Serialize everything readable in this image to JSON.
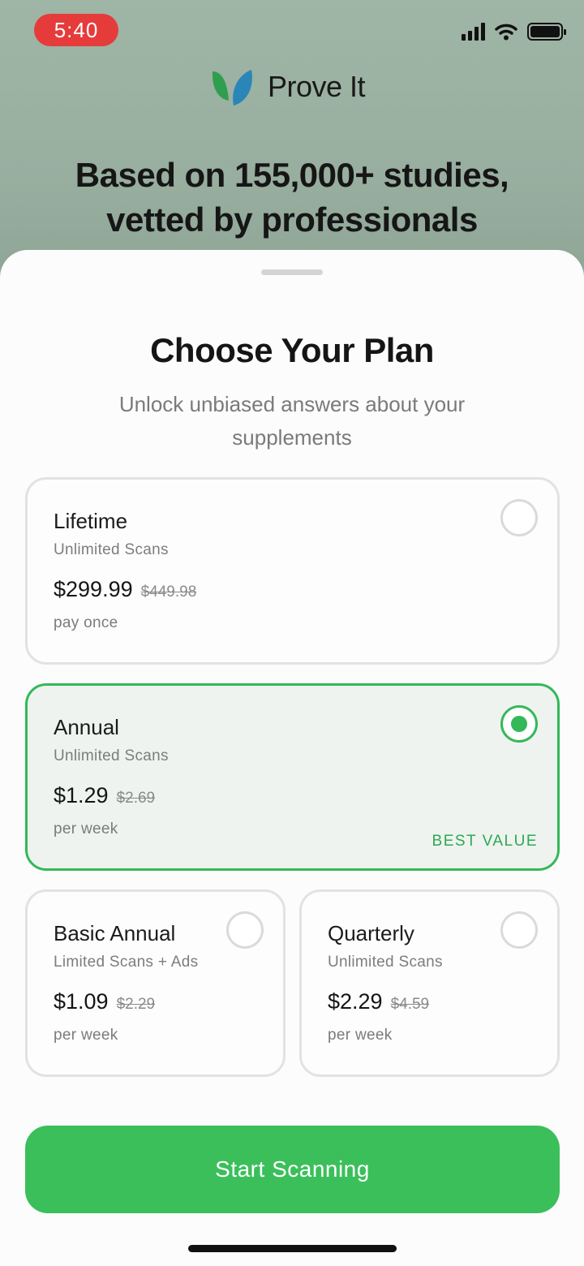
{
  "status_bar": {
    "time": "5:40"
  },
  "brand": {
    "name": "Prove It"
  },
  "hero": {
    "line1": "Based on 155,000+ studies,",
    "line2": "vetted by professionals"
  },
  "sheet": {
    "title": "Choose Your Plan",
    "subtitle": "Unlock unbiased answers about your supplements"
  },
  "plans": [
    {
      "name": "Lifetime",
      "feature": "Unlimited Scans",
      "price": "$299.99",
      "old_price": "$449.98",
      "period": "pay once",
      "selected": false
    },
    {
      "name": "Annual",
      "feature": "Unlimited Scans",
      "price": "$1.29",
      "old_price": "$2.69",
      "period": "per week",
      "badge": "BEST VALUE",
      "selected": true
    },
    {
      "name": "Basic Annual",
      "feature": "Limited Scans + Ads",
      "price": "$1.09",
      "old_price": "$2.29",
      "period": "per week",
      "selected": false
    },
    {
      "name": "Quarterly",
      "feature": "Unlimited Scans",
      "price": "$2.29",
      "old_price": "$4.59",
      "period": "per week",
      "selected": false
    }
  ],
  "cta": {
    "label": "Start Scanning"
  },
  "colors": {
    "accent": "#3bbf5b",
    "time_pill": "#e63b3b",
    "backdrop": "#99b09f"
  },
  "icons": [
    "signal-icon",
    "wifi-icon",
    "battery-icon",
    "prove-it-logo-icon",
    "radio-unselected-icon",
    "radio-selected-icon"
  ]
}
